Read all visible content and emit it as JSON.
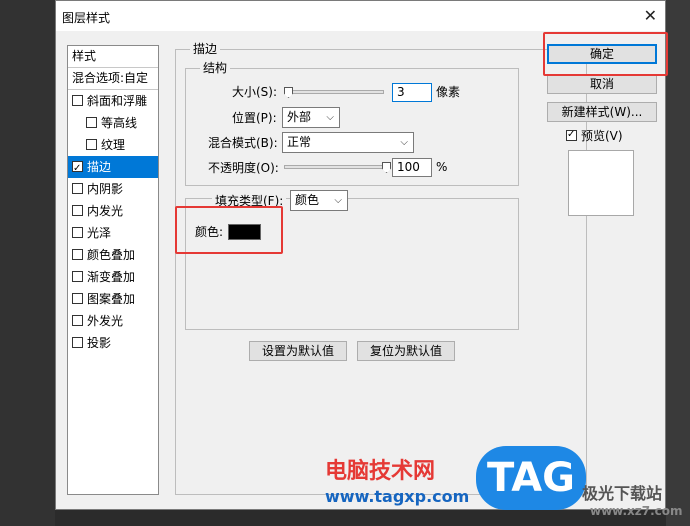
{
  "window": {
    "title": "图层样式",
    "close_glyph": "✕"
  },
  "styles": {
    "header": "样式",
    "blend_options": "混合选项:自定",
    "items": [
      {
        "label": "斜面和浮雕",
        "checked": false,
        "indent": false
      },
      {
        "label": "等高线",
        "checked": false,
        "indent": true
      },
      {
        "label": "纹理",
        "checked": false,
        "indent": true
      },
      {
        "label": "描边",
        "checked": true,
        "indent": false,
        "selected": true
      },
      {
        "label": "内阴影",
        "checked": false,
        "indent": false
      },
      {
        "label": "内发光",
        "checked": false,
        "indent": false
      },
      {
        "label": "光泽",
        "checked": false,
        "indent": false
      },
      {
        "label": "颜色叠加",
        "checked": false,
        "indent": false
      },
      {
        "label": "渐变叠加",
        "checked": false,
        "indent": false
      },
      {
        "label": "图案叠加",
        "checked": false,
        "indent": false
      },
      {
        "label": "外发光",
        "checked": false,
        "indent": false
      },
      {
        "label": "投影",
        "checked": false,
        "indent": false
      }
    ]
  },
  "stroke": {
    "group_title": "描边",
    "structure": {
      "title": "结构",
      "size_label": "大小(S):",
      "size_value": "3",
      "size_unit": "像素",
      "position_label": "位置(P):",
      "position_value": "外部",
      "blend_label": "混合模式(B):",
      "blend_value": "正常",
      "opacity_label": "不透明度(O):",
      "opacity_value": "100",
      "opacity_unit": "%"
    },
    "fill": {
      "type_label": "填充类型(F):",
      "type_value": "颜色",
      "color_label": "颜色:",
      "color_hex": "#000000"
    },
    "set_default": "设置为默认值",
    "reset_default": "复位为默认值"
  },
  "actions": {
    "ok": "确定",
    "cancel": "取消",
    "new_style": "新建样式(W)...",
    "preview_label": "预览(V)",
    "preview_checked": true
  },
  "watermark": {
    "brand": "电脑技术网",
    "url": "www.tagxp.com",
    "tag": "TAG",
    "site": "极光下载站",
    "site_url": "www.xz7.com"
  },
  "colors": {
    "accent": "#0078d7",
    "highlight": "#e53935"
  }
}
